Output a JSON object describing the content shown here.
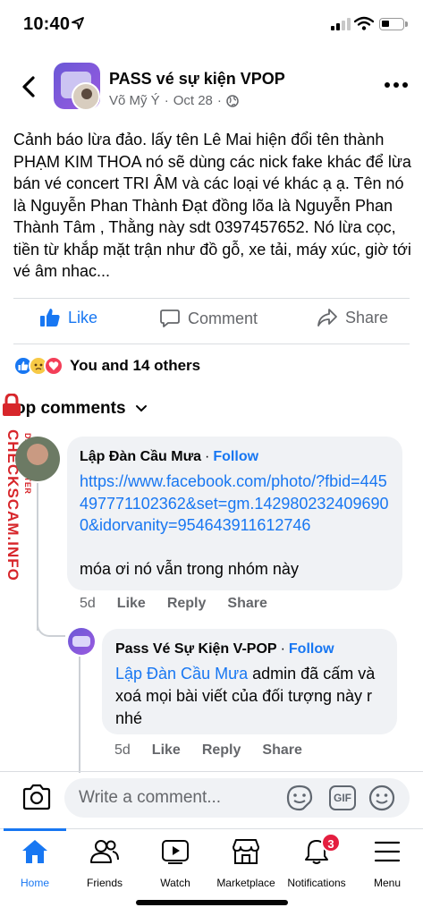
{
  "status_bar": {
    "time": "10:40"
  },
  "post": {
    "group_name": "PASS vé sự kiện VPOP",
    "author": "Võ Mỹ Ý",
    "date": "Oct 28",
    "body": "Cảnh báo lừa đảo. lấy tên Lê Mai hiện đổi tên thành PHẠM KIM THOA nó sẽ dùng các nick fake khác để lừa bán vé concert TRI ÂM và các loại vé khác ạ ạ. Tên nó là Nguyễn Phan Thành Đạt đồng lõa là Nguyễn Phan Thành Tâm , Thằng này sdt 0397457652. Nó lừa cọc, tiền từ khắp mặt trận như đồ gỗ, xe tải, máy xúc, giờ tới vé âm nhac..."
  },
  "actions": {
    "like": "Like",
    "comment": "Comment",
    "share": "Share"
  },
  "reactions": {
    "text": "You and 14 others",
    "types": [
      "like-reaction-icon",
      "sad-reaction-icon",
      "love-reaction-icon"
    ]
  },
  "top_comments_label": "op comments",
  "watermark": {
    "main": "CHECKSCAM.INFO",
    "sub": "DATA CENTER"
  },
  "comments": [
    {
      "name": "Lập Đàn Cầu Mưa",
      "follow": "Follow",
      "link": "https://www.facebook.com/photo/?fbid=445497771102362&set=gm.1429802324096900&idorvanity=954643911612746",
      "text": "móa ơi nó vẫn trong nhóm này",
      "age": "5d",
      "like": "Like",
      "reply": "Reply",
      "share": "Share"
    },
    {
      "name": "Pass Vé Sự Kiện V-POP",
      "follow": "Follow",
      "mention": "Lập Đàn Cầu Mưa",
      "text": " admin đã cấm và xoá mọi bài viết của đối tượng này r nhé",
      "age": "5d",
      "like": "Like",
      "reply": "Reply",
      "share": "Share"
    }
  ],
  "composer": {
    "placeholder": "Write a comment...",
    "gif": "GIF"
  },
  "tabbar": {
    "tabs": [
      {
        "label": "Home"
      },
      {
        "label": "Friends"
      },
      {
        "label": "Watch"
      },
      {
        "label": "Marketplace"
      },
      {
        "label": "Notifications",
        "badge": "3"
      },
      {
        "label": "Menu"
      }
    ]
  },
  "colors": {
    "accent": "#1877f2",
    "bubble": "#f0f2f5",
    "muted": "#65676b",
    "watermark": "#d7262b",
    "badge": "#e41e3f"
  }
}
